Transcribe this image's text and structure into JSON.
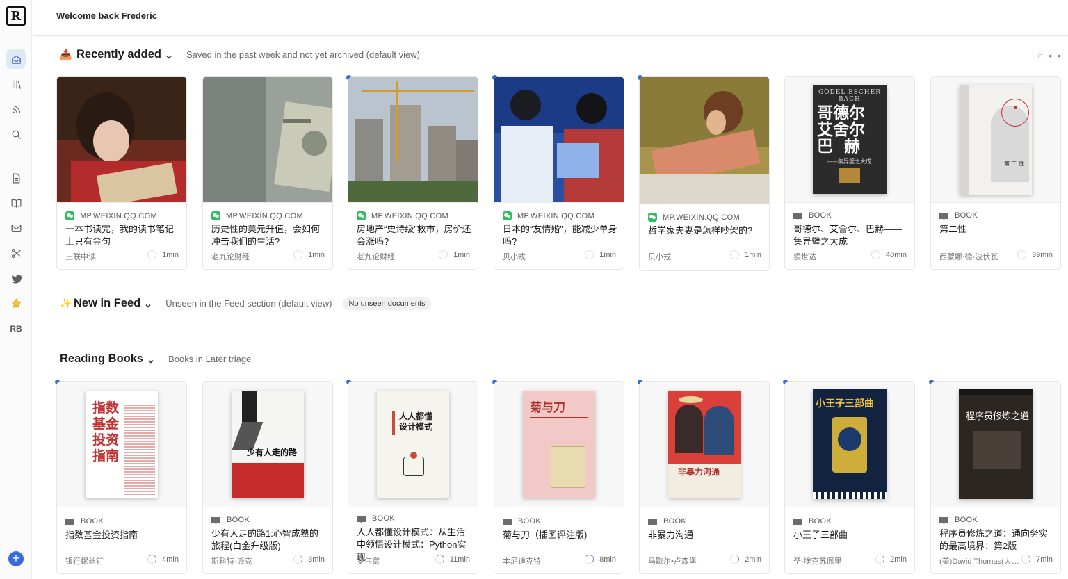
{
  "header": {
    "welcome": "Welcome back Frederic",
    "logo": "R"
  },
  "sidebar": {
    "items": [
      {
        "name": "home-icon",
        "active": true
      },
      {
        "name": "library-icon"
      },
      {
        "name": "rss-icon"
      },
      {
        "name": "search-icon"
      },
      {
        "name": "document-icon"
      },
      {
        "name": "book-icon"
      },
      {
        "name": "mail-icon"
      },
      {
        "name": "scissors-icon"
      },
      {
        "name": "twitter-icon"
      },
      {
        "name": "star-icon"
      }
    ],
    "rb_label": "RB",
    "add_label": "+"
  },
  "recently_added": {
    "emoji": "📥",
    "title": "Recently added",
    "description": "Saved in the past week and not yet archived (default view)",
    "more": "⋯",
    "cards": [
      {
        "source": "MP.WEIXIN.QQ.COM",
        "title": "一本书读完，我的读书笔记上只有金句",
        "author": "三联中读",
        "time": "1min",
        "unread": false
      },
      {
        "source": "MP.WEIXIN.QQ.COM",
        "title": "历史性的美元升值，会如何冲击我们的生活?",
        "author": "老九论财经",
        "time": "1min",
        "unread": false
      },
      {
        "source": "MP.WEIXIN.QQ.COM",
        "title": "房地产“史诗级”救市，房价还会涨吗?",
        "author": "老九论财经",
        "time": "1min",
        "unread": true
      },
      {
        "source": "MP.WEIXIN.QQ.COM",
        "title": "日本的“友情婚”，能减少单身吗?",
        "author": "贝小戎",
        "time": "1min",
        "unread": true
      },
      {
        "source": "MP.WEIXIN.QQ.COM",
        "title": "哲学家夫妻是怎样吵架的?",
        "author": "贝小戎",
        "time": "1min",
        "unread": true
      },
      {
        "source": "BOOK",
        "title": "哥德尔、艾舍尔、巴赫——集异璧之大成",
        "author": "侯世达",
        "time": "40min",
        "unread": false
      },
      {
        "source": "BOOK",
        "title": "第二性",
        "author": "西蒙娜·德·波伏瓦",
        "time": "39min",
        "unread": false
      }
    ]
  },
  "new_in_feed": {
    "emoji": "✨",
    "title": "New in Feed",
    "description": "Unseen in the Feed section (default view)",
    "badge": "No unseen documents"
  },
  "reading_books": {
    "title": "Reading Books",
    "description": "Books in Later triage",
    "cards": [
      {
        "source": "BOOK",
        "title": "指数基金投资指南",
        "author": "银行螺丝钉",
        "time": "4min",
        "cover_title": "指数\n基金\n投资\n指南"
      },
      {
        "source": "BOOK",
        "title": "少有人走的路1:心智成熟的旅程(白金升级版)",
        "author": "斯科特·派克",
        "time": "3min",
        "cover_title": "少有人走的路"
      },
      {
        "source": "BOOK",
        "title": "人人都懂设计模式：从生活中领悟设计模式：Python实现",
        "author": "罗伟富",
        "time": "11min",
        "cover_title": "人人都懂\n设计模式"
      },
      {
        "source": "BOOK",
        "title": "菊与刀（插图评注版)",
        "author": "本尼迪克特",
        "time": "8min",
        "cover_title": "菊与刀"
      },
      {
        "source": "BOOK",
        "title": "非暴力沟通",
        "author": "马歇尔•卢森堡",
        "time": "2min",
        "cover_title": "非暴力沟通"
      },
      {
        "source": "BOOK",
        "title": "小王子三部曲",
        "author": "圣-埃克苏佩里",
        "time": "2min",
        "cover_title": "小王子三部曲"
      },
      {
        "source": "BOOK",
        "title": "程序员修炼之道：通向务实的最高境界：第2版",
        "author": "(美)David Thomas(大…",
        "time": "7min",
        "cover_title": "程序员修炼之道"
      }
    ]
  },
  "book_covers_top": {
    "geb": "哥德尔\n艾舍尔\n巴  赫",
    "geb_sub": "GÖDEL ESCHER BACH",
    "geb_line": "——集异璧之大成",
    "second_sex": "第 二 性"
  }
}
